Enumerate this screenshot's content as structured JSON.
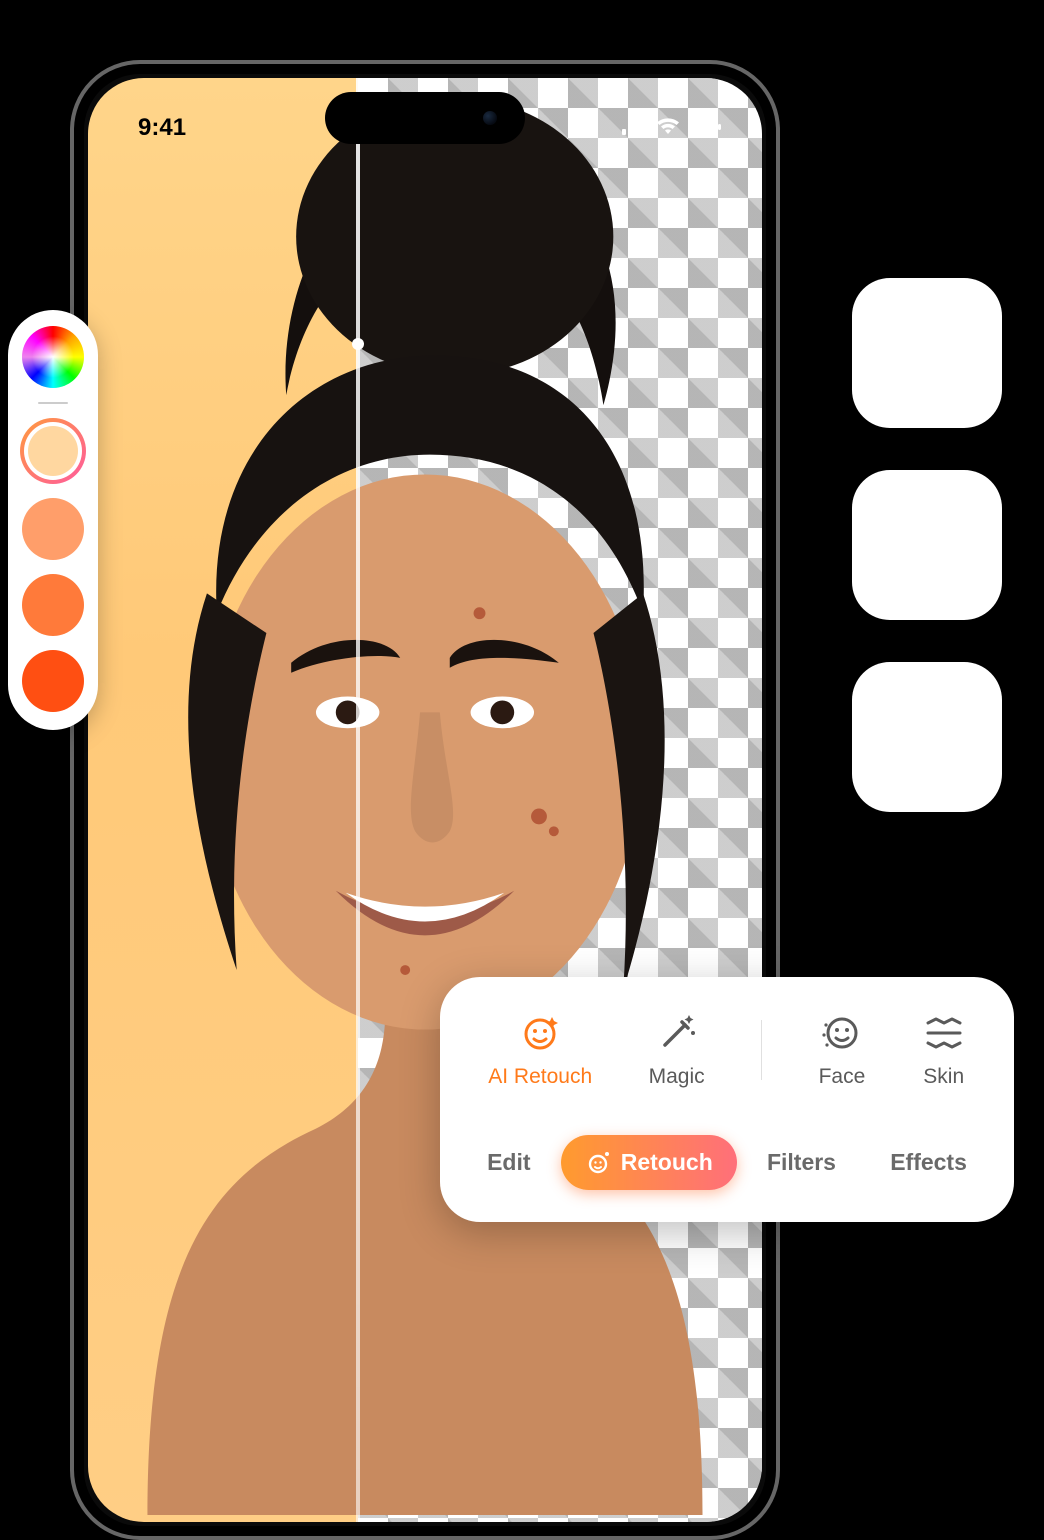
{
  "status_bar": {
    "time": "9:41"
  },
  "color_panel": {
    "swatches": [
      {
        "hex": "#ffd7a0",
        "selected": true
      },
      {
        "hex": "#ff9e6a",
        "selected": false
      },
      {
        "hex": "#ff7a3a",
        "selected": false
      },
      {
        "hex": "#ff4f12",
        "selected": false
      }
    ]
  },
  "tools": {
    "items": [
      {
        "id": "ai-retouch",
        "label": "AI Retouch",
        "active": true
      },
      {
        "id": "magic",
        "label": "Magic",
        "active": false
      },
      {
        "id": "face",
        "label": "Face",
        "active": false
      },
      {
        "id": "skin",
        "label": "Skin",
        "active": false
      }
    ]
  },
  "tabs": {
    "items": [
      {
        "id": "edit",
        "label": "Edit",
        "active": false
      },
      {
        "id": "retouch",
        "label": "Retouch",
        "active": true
      },
      {
        "id": "filters",
        "label": "Filters",
        "active": false
      },
      {
        "id": "effects",
        "label": "Effects",
        "active": false
      }
    ]
  },
  "accent": {
    "primary": "#ff7a1a",
    "gradient_start": "#ff9b2e",
    "gradient_end": "#ff6f7a"
  }
}
